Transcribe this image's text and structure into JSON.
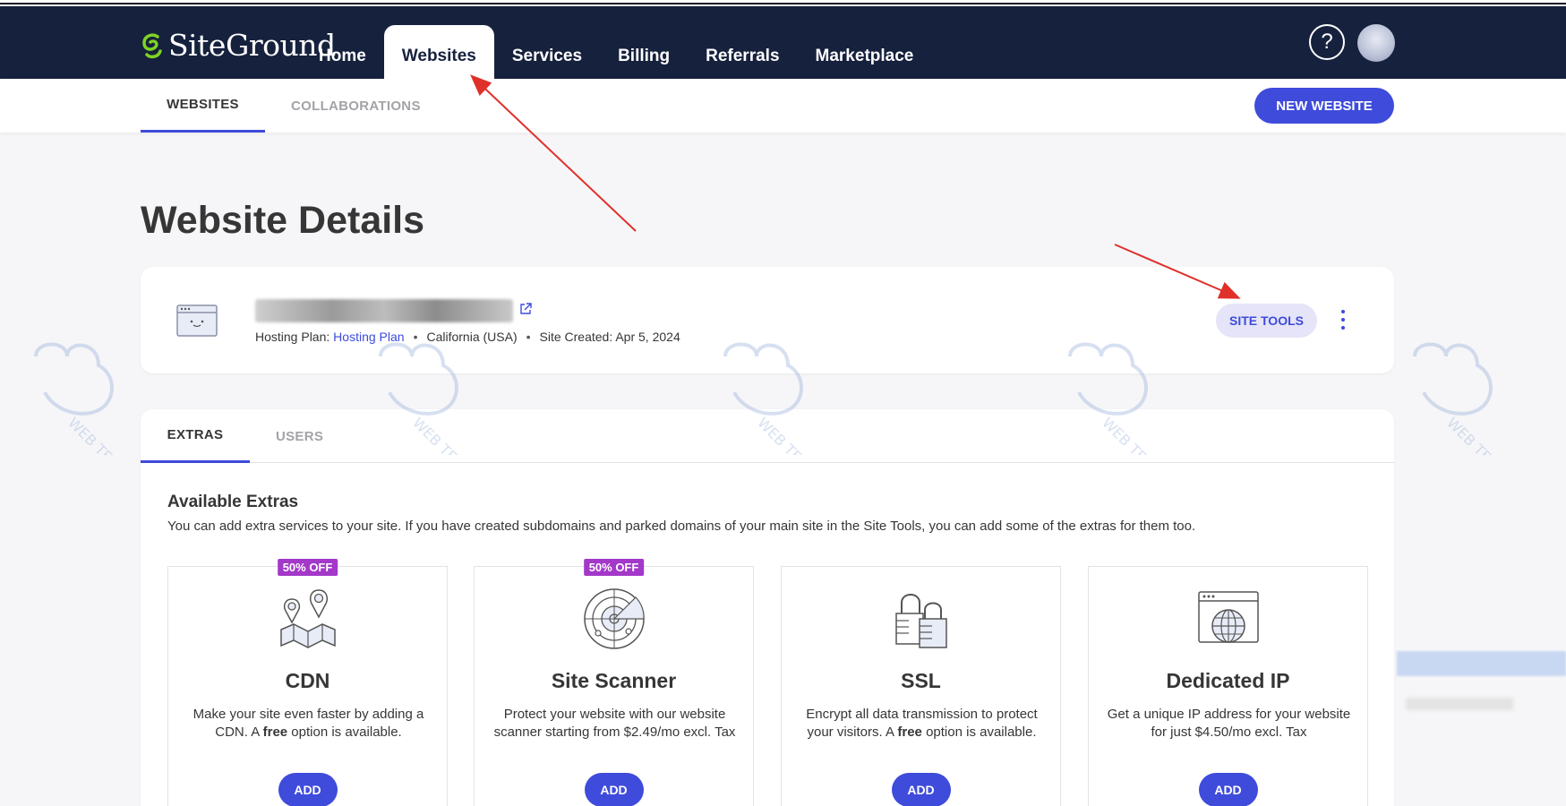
{
  "brand": {
    "name": "SiteGround"
  },
  "nav": {
    "items": [
      {
        "label": "Home"
      },
      {
        "label": "Websites"
      },
      {
        "label": "Services"
      },
      {
        "label": "Billing"
      },
      {
        "label": "Referrals"
      },
      {
        "label": "Marketplace"
      }
    ],
    "active": "Websites",
    "help_label": "?"
  },
  "subnav": {
    "tabs": [
      {
        "label": "WEBSITES"
      },
      {
        "label": "COLLABORATIONS"
      }
    ],
    "new_website_label": "NEW WEBSITE"
  },
  "page": {
    "title": "Website Details"
  },
  "site": {
    "hosting_plan_prefix": "Hosting Plan:",
    "hosting_plan_value": "Hosting Plan",
    "location": "California (USA)",
    "created": "Site Created: Apr 5, 2024",
    "site_tools_label": "SITE TOOLS"
  },
  "extras": {
    "tabs": [
      {
        "label": "EXTRAS"
      },
      {
        "label": "USERS"
      }
    ],
    "title": "Available Extras",
    "description": "You can add extra services to your site. If you have created subdomains and parked domains of your main site in the Site Tools, you can add some of the extras for them too.",
    "tiles": [
      {
        "badge": "50% OFF",
        "title": "CDN",
        "desc_a": "Make your site even faster by adding a CDN. A ",
        "desc_bold": "free",
        "desc_b": " option is available.",
        "button": "ADD",
        "icon": "map-pins-icon"
      },
      {
        "badge": "50% OFF",
        "title": "Site Scanner",
        "desc_a": "Protect your website with our website scanner starting from $2.49/mo excl. Tax",
        "desc_bold": "",
        "desc_b": "",
        "button": "ADD",
        "icon": "radar-icon"
      },
      {
        "badge": "",
        "title": "SSL",
        "desc_a": "Encrypt all data transmission to protect your visitors. A ",
        "desc_bold": "free",
        "desc_b": " option is available.",
        "button": "ADD",
        "icon": "padlocks-icon"
      },
      {
        "badge": "",
        "title": "Dedicated IP",
        "desc_a": "Get a unique IP address for your website for just $4.50/mo excl. Tax",
        "desc_bold": "",
        "desc_b": "",
        "button": "ADD",
        "icon": "globe-window-icon"
      }
    ]
  },
  "watermark": {
    "text": "WEB TEK"
  },
  "colors": {
    "navy": "#16213d",
    "accent": "#3e4bdb",
    "badge": "#a338c9",
    "arrow": "#e0302a"
  }
}
